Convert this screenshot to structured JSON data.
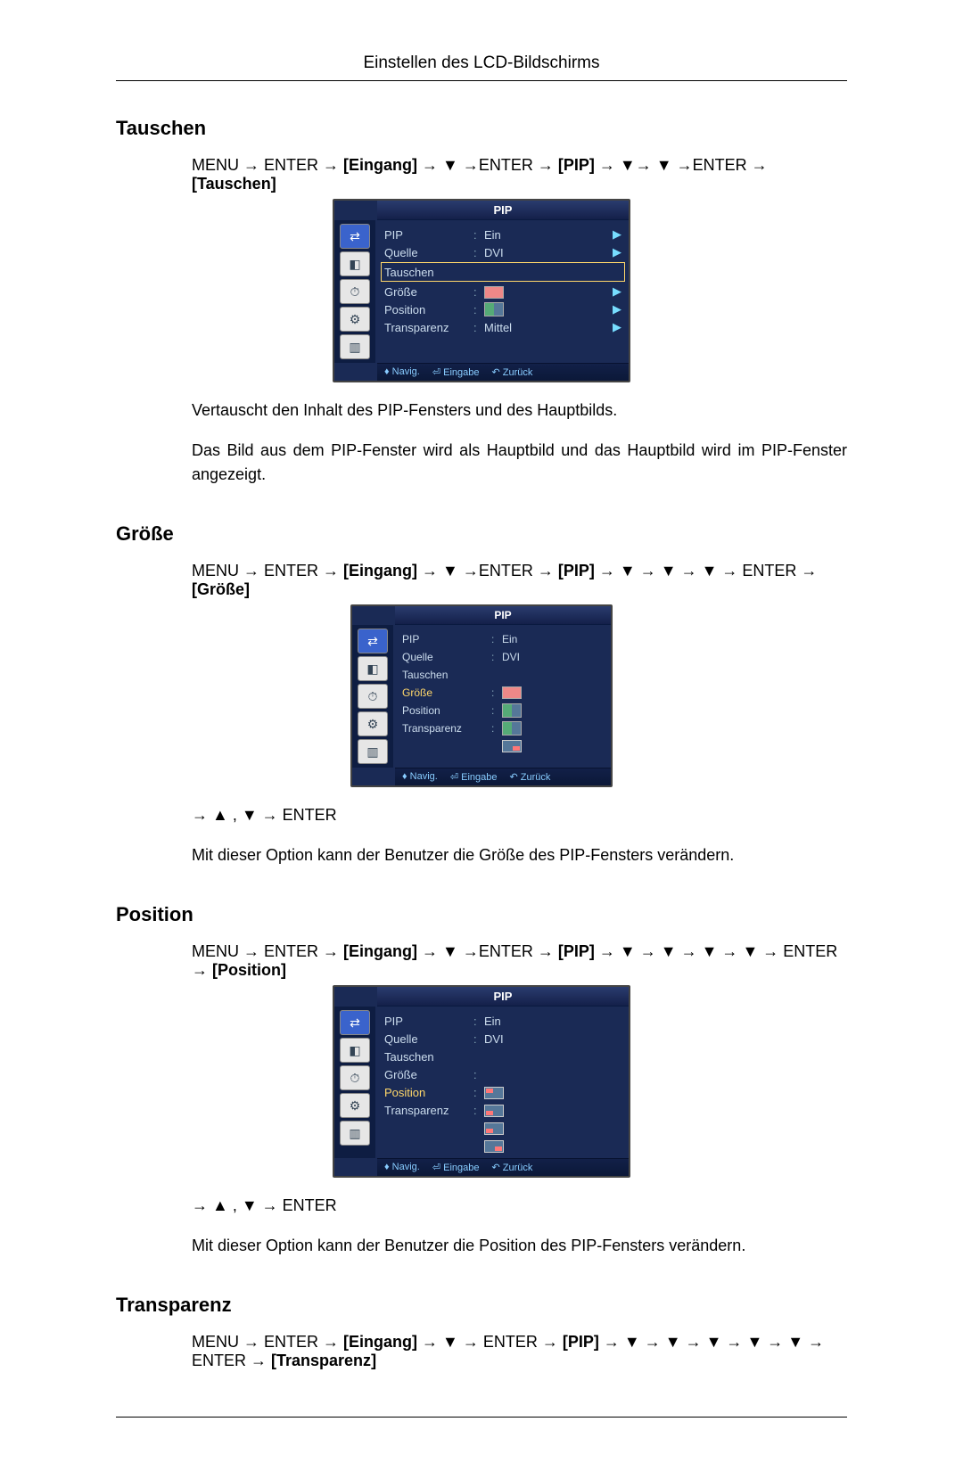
{
  "header": "Einstellen des LCD-Bildschirms",
  "sections": {
    "tauschen": {
      "title": "Tauschen",
      "nav": "MENU → ENTER → [Eingang] → ▼ →ENTER → [PIP] → ▼→ ▼ →ENTER → [Tauschen]",
      "desc1": "Vertauscht den Inhalt des PIP-Fensters und des Hauptbilds.",
      "desc2": "Das Bild aus dem PIP-Fenster wird als Hauptbild und das Hauptbild wird im PIP-Fenster angezeigt."
    },
    "groesse": {
      "title": "Größe",
      "nav": "MENU → ENTER → [Eingang] → ▼ →ENTER → [PIP] → ▼ → ▼ → ▼ → ENTER → [Größe]",
      "post_nav": "→ ▲ , ▼ → ENTER",
      "desc": "Mit dieser Option kann der Benutzer die Größe des PIP-Fensters verändern."
    },
    "position": {
      "title": "Position",
      "nav": "MENU → ENTER → [Eingang] → ▼ →ENTER → [PIP] → ▼ → ▼ → ▼ → ▼ → ENTER → [Position]",
      "post_nav": "→ ▲ , ▼ → ENTER",
      "desc": "Mit dieser Option kann der Benutzer die Position des PIP-Fensters verändern."
    },
    "transparenz": {
      "title": "Transparenz",
      "nav": "MENU → ENTER → [Eingang] → ▼ → ENTER → [PIP] → ▼ → ▼ → ▼ → ▼ → ▼ → ENTER → [Transparenz]"
    }
  },
  "osd_common": {
    "title": "PIP",
    "rows": {
      "pip_label": "PIP",
      "pip_value": "Ein",
      "quelle_label": "Quelle",
      "quelle_value": "DVI",
      "tauschen_label": "Tauschen",
      "groesse_label": "Größe",
      "position_label": "Position",
      "transparenz_label": "Transparenz",
      "transparenz_value": "Mittel"
    },
    "footer": {
      "navig": "Navig.",
      "eingabe": "Eingabe",
      "zurueck": "Zurück"
    }
  },
  "osd_variants": {
    "tauschen_highlight": "Tauschen",
    "groesse_highlight": "Größe",
    "position_highlight": "Position"
  }
}
